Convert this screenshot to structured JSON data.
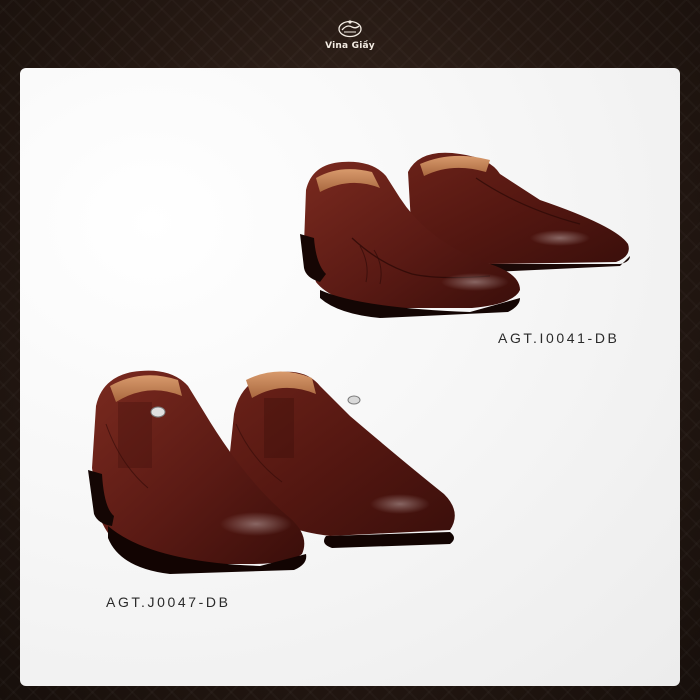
{
  "header": {
    "brand_name": "Vina Giầy",
    "logo_icon": "vina-giay-emblem-icon"
  },
  "products": [
    {
      "code": "AGT.I0041-DB",
      "image": "brown-leather-loafer-pair"
    },
    {
      "code": "AGT.J0047-DB",
      "image": "brown-leather-slip-on-pair"
    }
  ],
  "colors": {
    "background": "#241812",
    "card": "#f4f4f4",
    "leather": "#5a1a14",
    "lining": "#c98a5e"
  }
}
